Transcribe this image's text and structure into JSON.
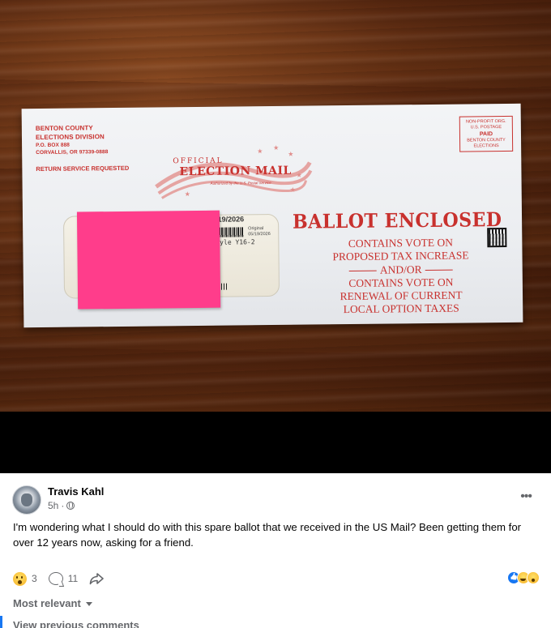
{
  "envelope": {
    "return_address": [
      "BENTON COUNTY",
      "ELECTIONS DIVISION"
    ],
    "return_address_small": [
      "P.O. BOX 888",
      "CORVALLIS, OR 97339-0888"
    ],
    "return_service": "RETURN SERVICE REQUESTED",
    "postage": [
      "NON-PROFIT ORG.",
      "U.S. POSTAGE"
    ],
    "postage_paid": "PAID",
    "postage_bottom": [
      "BENTON COUNTY",
      "ELECTIONS"
    ],
    "official": "OFFICIAL",
    "election_mail": "ELECTION MAIL",
    "authorized": "Authorized by the U.S. Postal Service",
    "window_date": "/19/2026",
    "window_original": [
      "Original",
      "05/19/2026"
    ],
    "window_style": "tyle Y16-2",
    "ballot_enclosed": "BALLOT ENCLOSED",
    "contains_lines": [
      "CONTAINS VOTE ON",
      "PROPOSED TAX INCREASE",
      "AND/OR",
      "CONTAINS VOTE ON",
      "RENEWAL OF CURRENT",
      "LOCAL OPTION TAXES"
    ],
    "color_red": "#c8312e",
    "sticky_color": "#ff3d8b"
  },
  "post": {
    "author": "Travis Kahl",
    "time": "5h",
    "separator": "·",
    "text": "I'm wondering what I should do with this spare ballot that we received in the US Mail? Been getting them for over 12 years now, asking for a friend.",
    "more": "•••",
    "reaction_count": "3",
    "comment_count": "11",
    "sort_label": "Most relevant",
    "view_previous": "View previous comments"
  },
  "colors": {
    "accent": "#1877f2",
    "secondary_text": "#65676b"
  }
}
